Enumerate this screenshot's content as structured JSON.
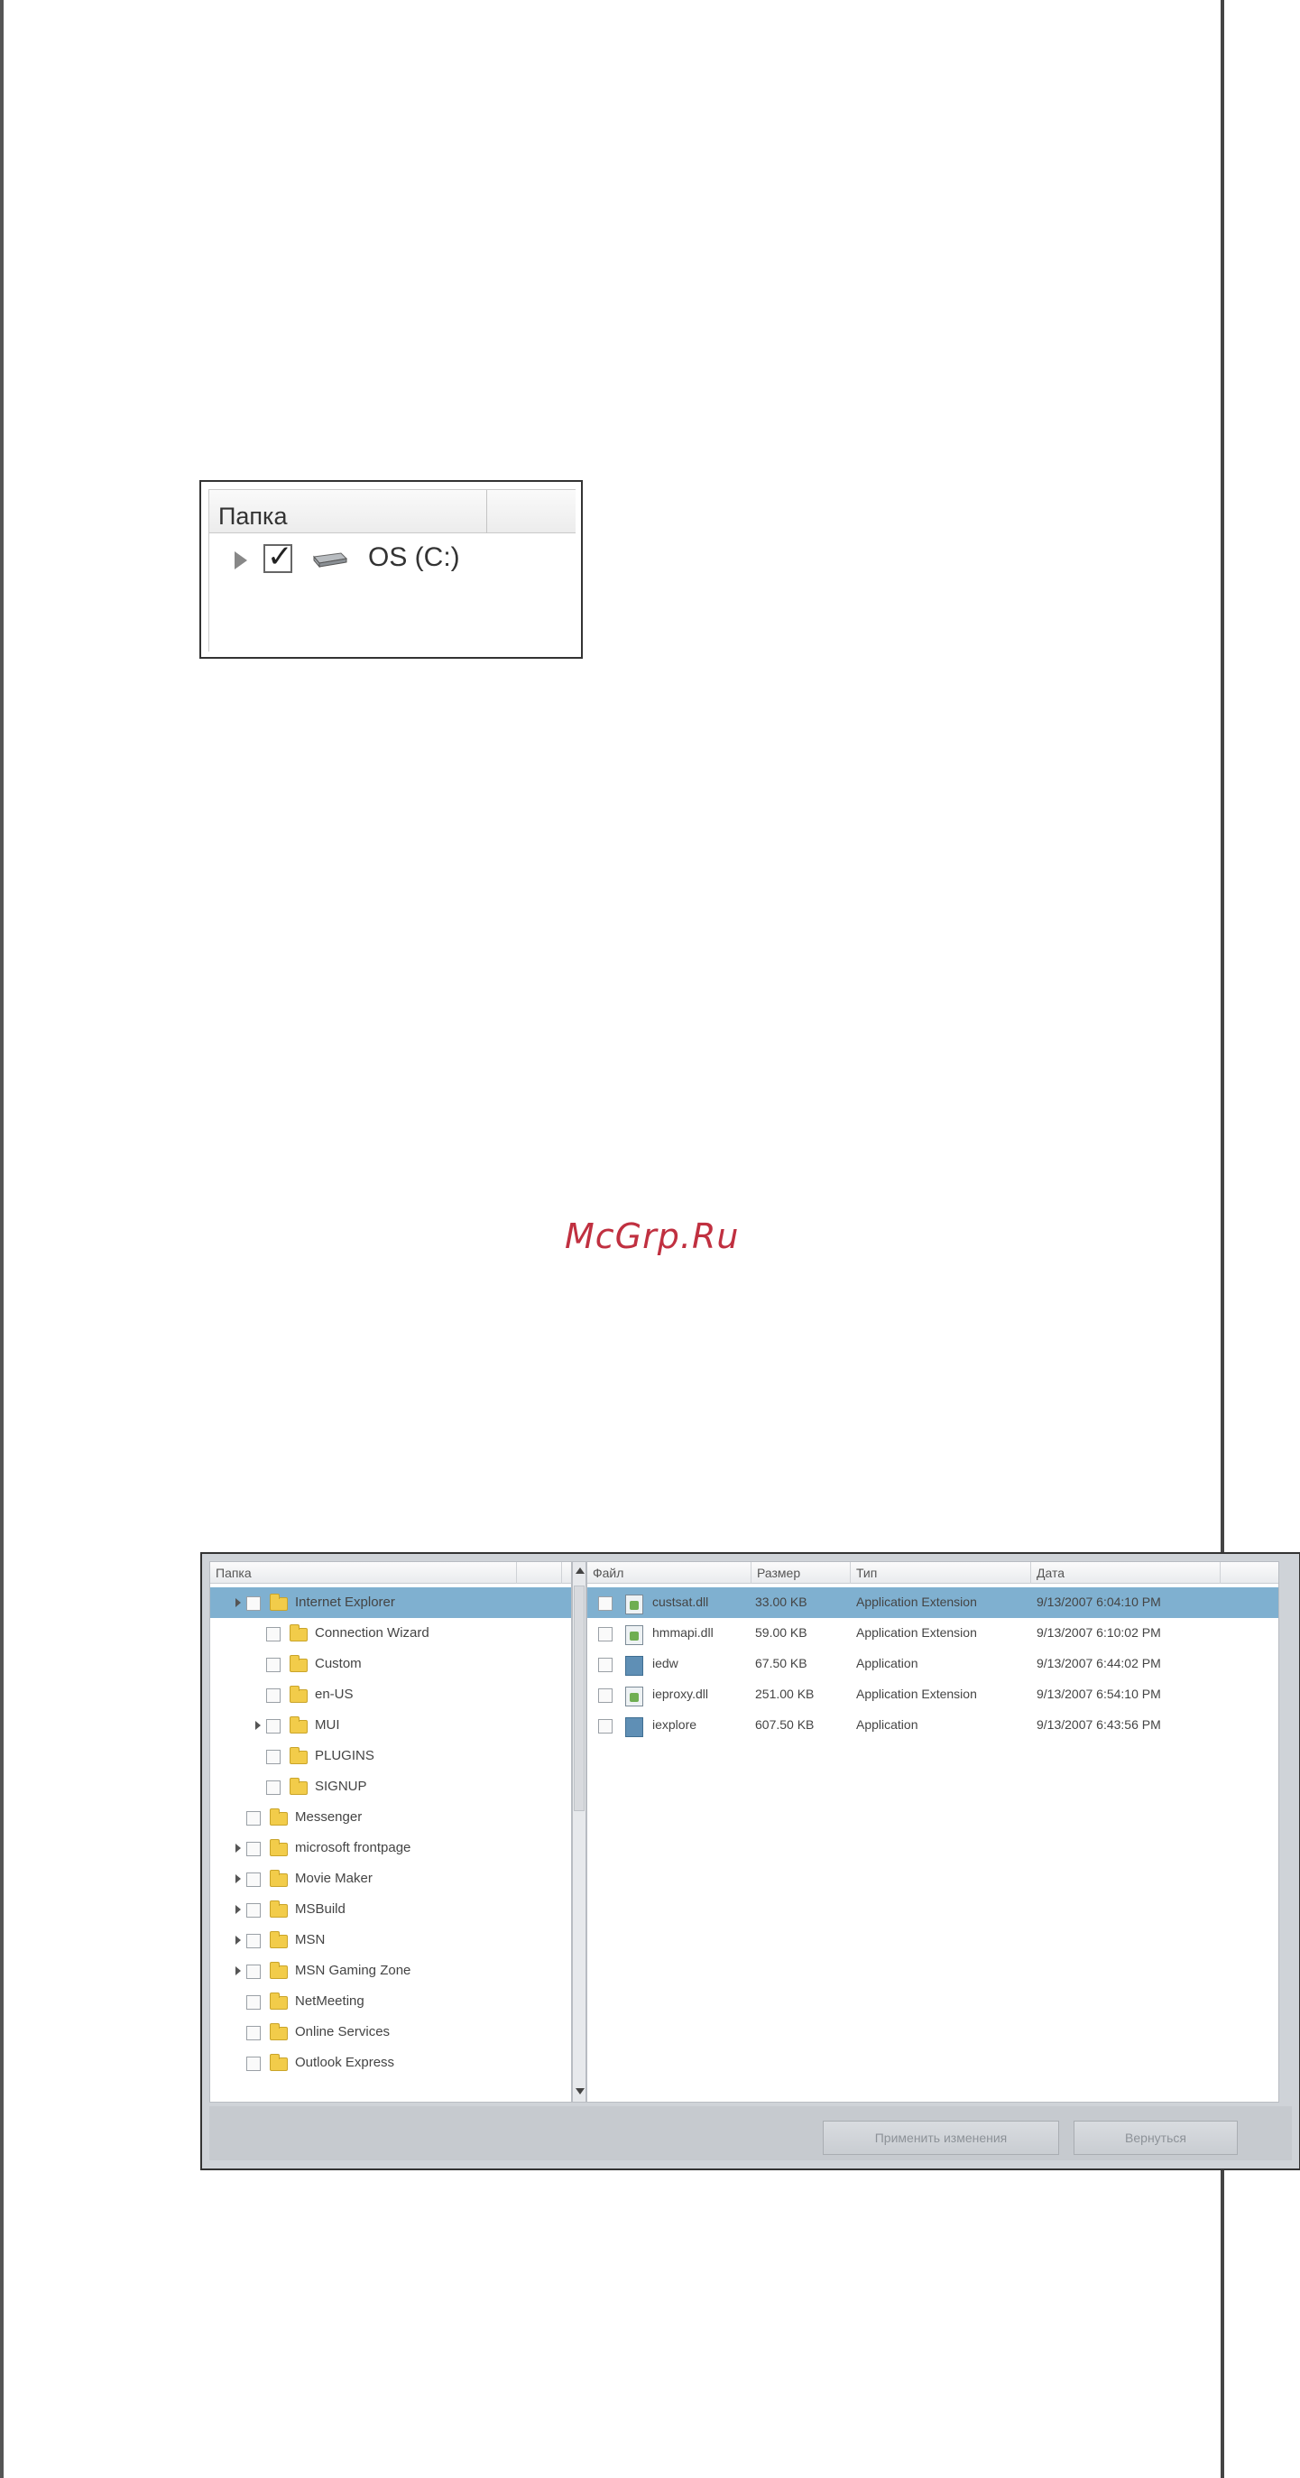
{
  "small_panel": {
    "header": "Папка",
    "drive_label": "OS (C:)",
    "checked": true
  },
  "watermark": "McGrp.Ru",
  "window": {
    "left_header": "Папка",
    "right_headers": {
      "file": "Файл",
      "size": "Размер",
      "type": "Тип",
      "date": "Дата"
    },
    "tree": [
      {
        "label": "Internet Explorer",
        "level": 0,
        "expandable": true,
        "selected": true
      },
      {
        "label": "Connection Wizard",
        "level": 1,
        "expandable": false,
        "selected": false
      },
      {
        "label": "Custom",
        "level": 1,
        "expandable": false,
        "selected": false
      },
      {
        "label": "en-US",
        "level": 1,
        "expandable": false,
        "selected": false
      },
      {
        "label": "MUI",
        "level": 1,
        "expandable": true,
        "selected": false
      },
      {
        "label": "PLUGINS",
        "level": 1,
        "expandable": false,
        "selected": false
      },
      {
        "label": "SIGNUP",
        "level": 1,
        "expandable": false,
        "selected": false
      },
      {
        "label": "Messenger",
        "level": 0,
        "expandable": false,
        "selected": false
      },
      {
        "label": "microsoft frontpage",
        "level": 0,
        "expandable": true,
        "selected": false
      },
      {
        "label": "Movie Maker",
        "level": 0,
        "expandable": true,
        "selected": false
      },
      {
        "label": "MSBuild",
        "level": 0,
        "expandable": true,
        "selected": false
      },
      {
        "label": "MSN",
        "level": 0,
        "expandable": true,
        "selected": false
      },
      {
        "label": "MSN Gaming Zone",
        "level": 0,
        "expandable": true,
        "selected": false
      },
      {
        "label": "NetMeeting",
        "level": 0,
        "expandable": false,
        "selected": false
      },
      {
        "label": "Online Services",
        "level": 0,
        "expandable": false,
        "selected": false
      },
      {
        "label": "Outlook Express",
        "level": 0,
        "expandable": false,
        "selected": false
      }
    ],
    "files": [
      {
        "name": "custsat.dll",
        "size": "33.00 KB",
        "type": "Application Extension",
        "date": "9/13/2007 6:04:10 PM",
        "icon": "dll",
        "selected": true
      },
      {
        "name": "hmmapi.dll",
        "size": "59.00 KB",
        "type": "Application Extension",
        "date": "9/13/2007 6:10:02 PM",
        "icon": "dll",
        "selected": false
      },
      {
        "name": "iedw",
        "size": "67.50 KB",
        "type": "Application",
        "date": "9/13/2007 6:44:02 PM",
        "icon": "app",
        "selected": false
      },
      {
        "name": "ieproxy.dll",
        "size": "251.00 KB",
        "type": "Application Extension",
        "date": "9/13/2007 6:54:10 PM",
        "icon": "dll",
        "selected": false
      },
      {
        "name": "iexplore",
        "size": "607.50 KB",
        "type": "Application",
        "date": "9/13/2007 6:43:56 PM",
        "icon": "app",
        "selected": false
      }
    ],
    "buttons": {
      "apply": "Применить изменения",
      "back": "Вернуться"
    }
  }
}
